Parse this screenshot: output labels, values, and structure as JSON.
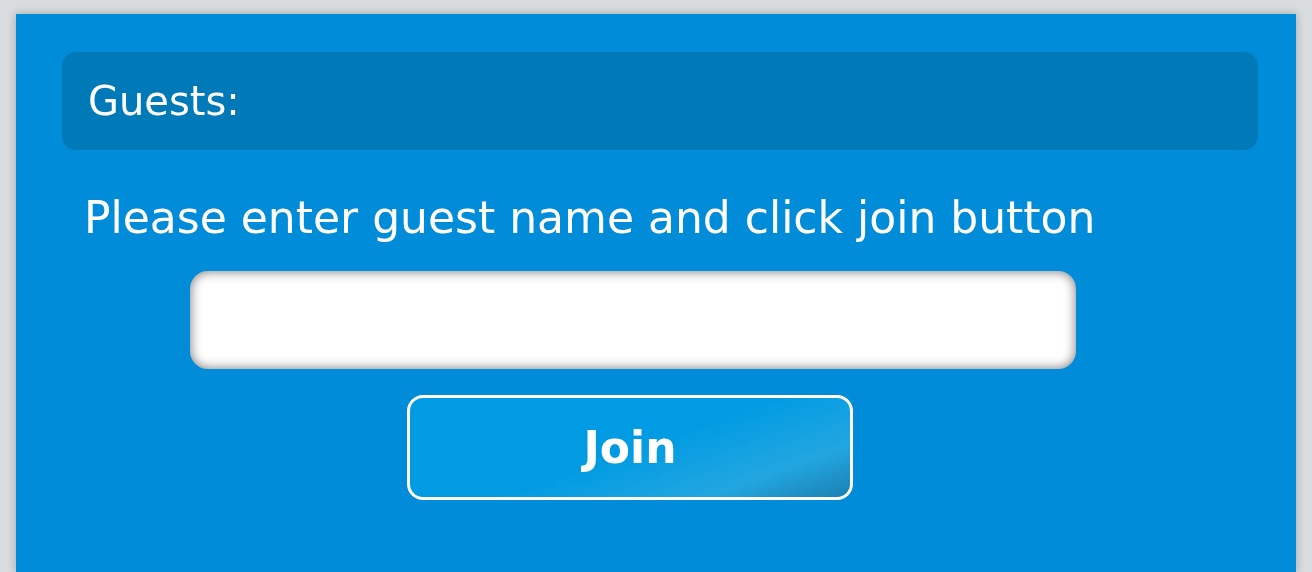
{
  "header": {
    "title": "Guests:"
  },
  "instruction": "Please enter guest name and click join button",
  "buttons": [
    {
      "label": "Join"
    }
  ]
}
